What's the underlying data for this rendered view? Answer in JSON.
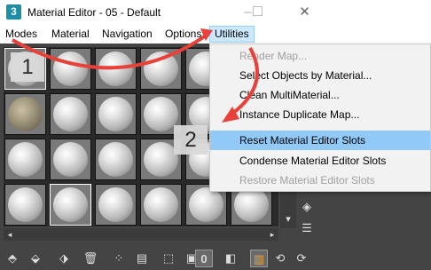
{
  "window": {
    "icon_label": "3",
    "title": "Material Editor - 05 - Default",
    "controls": [
      "–",
      "☐",
      "✕"
    ]
  },
  "menubar": {
    "items": [
      "Modes",
      "Material",
      "Navigation",
      "Options",
      "Utilities"
    ]
  },
  "utilities_menu": {
    "items": [
      {
        "label": "Render Map...",
        "enabled": false
      },
      {
        "label": "Select Objects by Material...",
        "enabled": true
      },
      {
        "label": "Clean MultiMaterial...",
        "enabled": true
      },
      {
        "label": "Instance Duplicate Map...",
        "enabled": true
      },
      {
        "label": "Reset Material Editor Slots",
        "enabled": true,
        "highlighted": true
      },
      {
        "label": "Condense Material Editor Slots",
        "enabled": true
      },
      {
        "label": "Restore Material Editor Slots",
        "enabled": false
      }
    ]
  },
  "annotations": {
    "step1": "1",
    "step2": "2",
    "arrow_color": "#e8413a"
  },
  "colors": {
    "menu_highlight": "#91c9f7",
    "active_menu": "#cce8ff",
    "panel_bg": "#444444"
  }
}
